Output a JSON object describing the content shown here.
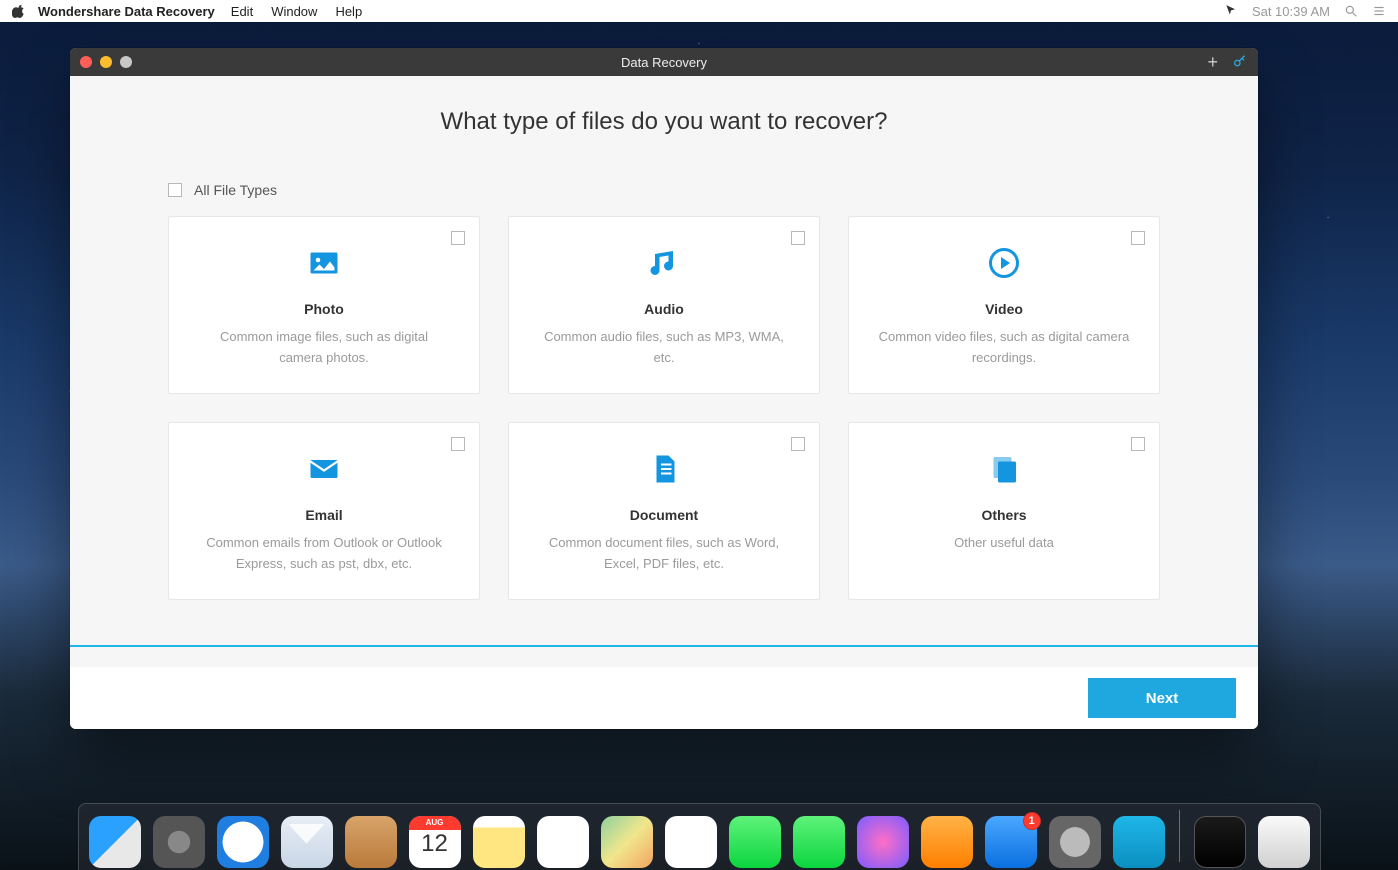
{
  "menubar": {
    "app_name": "Wondershare Data Recovery",
    "items": [
      "Edit",
      "Window",
      "Help"
    ],
    "clock": "Sat 10:39 AM"
  },
  "window": {
    "title": "Data Recovery",
    "heading": "What type of files do you want to recover?",
    "all_label": "All File Types",
    "next_label": "Next",
    "cards": [
      {
        "title": "Photo",
        "desc": "Common image files, such as digital camera photos."
      },
      {
        "title": "Audio",
        "desc": "Common audio files, such as MP3, WMA, etc."
      },
      {
        "title": "Video",
        "desc": "Common video files, such as digital camera recordings."
      },
      {
        "title": "Email",
        "desc": "Common emails from Outlook or Outlook Express, such as pst, dbx, etc."
      },
      {
        "title": "Document",
        "desc": "Common document files, such as Word, Excel, PDF files, etc."
      },
      {
        "title": "Others",
        "desc": "Other useful data"
      }
    ]
  },
  "dock": {
    "appstore_badge": "1",
    "items": [
      "finder",
      "launchpad",
      "safari",
      "mail",
      "contacts",
      "calendar",
      "notes",
      "reminders",
      "maps",
      "photos",
      "messages",
      "facetime",
      "itunes",
      "ibooks",
      "appstore",
      "settings",
      "wondershare"
    ],
    "right_items": [
      "folder",
      "trash"
    ],
    "running": [
      "finder",
      "wondershare"
    ]
  },
  "calendar": {
    "month": "AUG",
    "day": "12"
  }
}
